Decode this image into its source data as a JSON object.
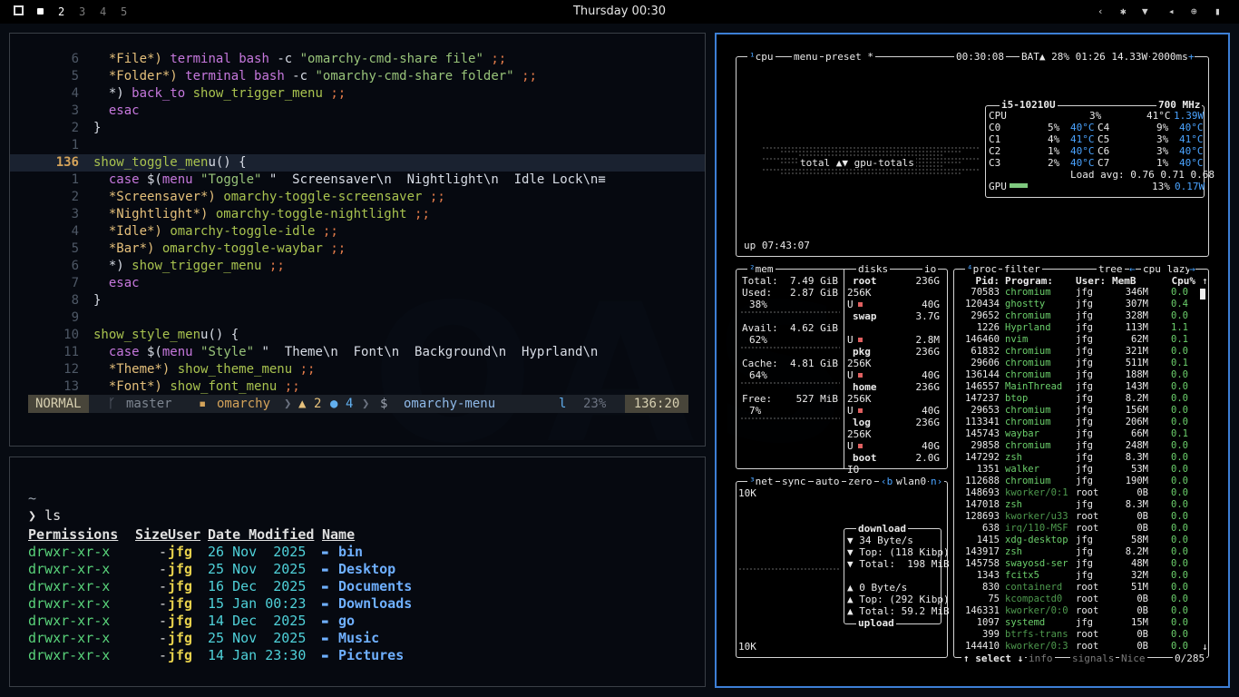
{
  "topbar": {
    "workspaces": [
      "2",
      "3",
      "4",
      "5"
    ],
    "clock": "Thursday 00:30"
  },
  "editor": {
    "lines": [
      {
        "num": "6",
        "code": "  *File*) terminal bash -c \"omarchy-cmd-share file\" ;;"
      },
      {
        "num": "5",
        "code": "  *Folder*) terminal bash -c \"omarchy-cmd-share folder\" ;;"
      },
      {
        "num": "4",
        "code": "  *) back_to show_trigger_menu ;;"
      },
      {
        "num": "3",
        "code": "  esac"
      },
      {
        "num": "2",
        "code": "}"
      },
      {
        "num": "1",
        "code": ""
      },
      {
        "num": "136",
        "code": "show_toggle_menu() {",
        "current": true
      },
      {
        "num": "1",
        "code": "  case $(menu \"Toggle\" \"  Screensaver\\n  Nightlight\\n  Idle Lock\\n≡"
      },
      {
        "num": "2",
        "code": "  *Screensaver*) omarchy-toggle-screensaver ;;"
      },
      {
        "num": "3",
        "code": "  *Nightlight*) omarchy-toggle-nightlight ;;"
      },
      {
        "num": "4",
        "code": "  *Idle*) omarchy-toggle-idle ;;"
      },
      {
        "num": "5",
        "code": "  *Bar*) omarchy-toggle-waybar ;;"
      },
      {
        "num": "6",
        "code": "  *) show_trigger_menu ;;"
      },
      {
        "num": "7",
        "code": "  esac"
      },
      {
        "num": "8",
        "code": "}"
      },
      {
        "num": "9",
        "code": ""
      },
      {
        "num": "10",
        "code": "show_style_menu() {"
      },
      {
        "num": "11",
        "code": "  case $(menu \"Style\" \"  Theme\\n  Font\\n  Background\\n  Hyprland\\n"
      },
      {
        "num": "12",
        "code": "  *Theme*) show_theme_menu ;;"
      },
      {
        "num": "13",
        "code": "  *Font*) show_font_menu ;;"
      }
    ],
    "status": {
      "mode": "NORMAL",
      "branch": "master",
      "dir": "omarchy",
      "warnings": "2",
      "infos": "4",
      "prompt": "$",
      "file": "omarchy-menu",
      "ft": "l",
      "percent": "23%",
      "position": "136:20"
    }
  },
  "terminal": {
    "cwd": "~",
    "command": "ls",
    "headers": [
      "Permissions",
      "Size",
      "User",
      "Date Modified",
      "Name"
    ],
    "rows": [
      {
        "perm": "drwxr-xr-x",
        "size": "-",
        "user": "jfg",
        "date": "26 Nov  2025",
        "name": "bin"
      },
      {
        "perm": "drwxr-xr-x",
        "size": "-",
        "user": "jfg",
        "date": "25 Nov  2025",
        "name": "Desktop"
      },
      {
        "perm": "drwxr-xr-x",
        "size": "-",
        "user": "jfg",
        "date": "16 Dec  2025",
        "name": "Documents"
      },
      {
        "perm": "drwxr-xr-x",
        "size": "-",
        "user": "jfg",
        "date": "15 Jan 00:23",
        "name": "Downloads"
      },
      {
        "perm": "drwxr-xr-x",
        "size": "-",
        "user": "jfg",
        "date": "14 Dec  2025",
        "name": "go"
      },
      {
        "perm": "drwxr-xr-x",
        "size": "-",
        "user": "jfg",
        "date": "25 Nov  2025",
        "name": "Music"
      },
      {
        "perm": "drwxr-xr-x",
        "size": "-",
        "user": "jfg",
        "date": "14 Jan 23:30",
        "name": "Pictures"
      }
    ]
  },
  "btop": {
    "cpu": {
      "title": "cpu",
      "menu": "menu",
      "preset": "preset *",
      "time": "00:30:08",
      "battery": "BAT▲ 28% 01:26 14.33W",
      "interval": "2000ms",
      "model": "i5-10210U",
      "freq": "700 MHz",
      "cores": [
        {
          "name": "CPU",
          "pct": "3%",
          "temp": "41°C",
          "extra": "1.39W"
        },
        {
          "name": "C0",
          "pct": "5%",
          "temp": "40°C"
        },
        {
          "name": "C1",
          "pct": "4%",
          "temp": "41°C"
        },
        {
          "name": "C2",
          "pct": "1%",
          "temp": "40°C"
        },
        {
          "name": "C3",
          "pct": "2%",
          "temp": "40°C"
        }
      ],
      "cores_right": [
        {
          "name": "C4",
          "pct": "9%",
          "temp": "40°C"
        },
        {
          "name": "C5",
          "pct": "3%",
          "temp": "41°C"
        },
        {
          "name": "C6",
          "pct": "3%",
          "temp": "40°C"
        },
        {
          "name": "C7",
          "pct": "1%",
          "temp": "40°C"
        }
      ],
      "load": "Load avg: 0.76 0.71 0.68",
      "gpu_label": "GPU",
      "gpu_pct": "13%",
      "gpu_w": "0.17W",
      "graph_label": "total ▲▼ gpu-totals",
      "uptime": "up 07:43:07"
    },
    "mem": {
      "title": "mem",
      "disks": "disks",
      "io": "io",
      "total": "7.49 GiB",
      "used": "2.87 GiB",
      "used_pct": "38%",
      "avail": "4.62 GiB",
      "avail_pct": "62%",
      "cache": "4.81 GiB",
      "cache_pct": "64%",
      "free": "527 MiB",
      "free_pct": "7%",
      "disk_list": [
        {
          "name": "root",
          "size": "236G",
          "a": "256K",
          "b": "40G"
        },
        {
          "name": "swap",
          "size": "3.7G",
          "a": "",
          "b": "2.8M"
        },
        {
          "name": "pkg",
          "size": "236G",
          "a": "256K",
          "b": "40G"
        },
        {
          "name": "home",
          "size": "236G",
          "a": "256K",
          "b": "40G"
        },
        {
          "name": "log",
          "size": "236G",
          "a": "256K",
          "b": "40G"
        },
        {
          "name": "boot",
          "size": "2.0G",
          "a": "IO",
          "b": ""
        }
      ]
    },
    "net": {
      "title": "net",
      "sync": "sync",
      "auto": "auto",
      "zero": "zero",
      "iface": "wlan0",
      "scale_top": "10K",
      "scale_bottom": "10K",
      "download": "download",
      "dl_rate": "▼ 34 Byte/s",
      "dl_top": "▼ Top: (118 Kibp)",
      "dl_total": "▼ Total:  198 MiB",
      "ul_rate": "▲ 0 Byte/s",
      "ul_top": "▲ Top: (292 Kibp)",
      "ul_total": "▲ Total: 59.2 MiB",
      "upload": "upload"
    },
    "proc": {
      "title": "proc",
      "filter": "filter",
      "tree": "tree",
      "sort": "cpu lazy",
      "headers": [
        "Pid:",
        "Program:",
        "User:",
        "MemB",
        "Cpu%"
      ],
      "rows": [
        [
          "70583",
          "chromium",
          "jfg",
          "346M",
          "0.0"
        ],
        [
          "120434",
          "ghostty",
          "jfg",
          "307M",
          "0.4"
        ],
        [
          "29652",
          "chromium",
          "jfg",
          "328M",
          "0.0"
        ],
        [
          "1226",
          "Hyprland",
          "jfg",
          "113M",
          "1.1"
        ],
        [
          "146460",
          "nvim",
          "jfg",
          "62M",
          "0.1"
        ],
        [
          "61832",
          "chromium",
          "jfg",
          "321M",
          "0.0"
        ],
        [
          "29606",
          "chromium",
          "jfg",
          "511M",
          "0.1"
        ],
        [
          "136144",
          "chromium",
          "jfg",
          "188M",
          "0.0"
        ],
        [
          "146557",
          "MainThread",
          "jfg",
          "143M",
          "0.0"
        ],
        [
          "147237",
          "btop",
          "jfg",
          "8.2M",
          "0.0"
        ],
        [
          "29653",
          "chromium",
          "jfg",
          "156M",
          "0.0"
        ],
        [
          "113341",
          "chromium",
          "jfg",
          "206M",
          "0.0"
        ],
        [
          "145743",
          "waybar",
          "jfg",
          "66M",
          "0.1"
        ],
        [
          "29858",
          "chromium",
          "jfg",
          "248M",
          "0.0"
        ],
        [
          "147292",
          "zsh",
          "jfg",
          "8.3M",
          "0.0"
        ],
        [
          "1351",
          "walker",
          "jfg",
          "53M",
          "0.0"
        ],
        [
          "112688",
          "chromium",
          "jfg",
          "190M",
          "0.0"
        ],
        [
          "148693",
          "kworker/0:1",
          "root",
          "0B",
          "0.0"
        ],
        [
          "147018",
          "zsh",
          "jfg",
          "8.3M",
          "0.0"
        ],
        [
          "128693",
          "kworker/u33",
          "root",
          "0B",
          "0.0"
        ],
        [
          "638",
          "irq/110-MSF",
          "root",
          "0B",
          "0.0"
        ],
        [
          "1415",
          "xdg-desktop",
          "jfg",
          "58M",
          "0.0"
        ],
        [
          "143917",
          "zsh",
          "jfg",
          "8.2M",
          "0.0"
        ],
        [
          "145758",
          "swayosd-ser",
          "jfg",
          "48M",
          "0.0"
        ],
        [
          "1343",
          "fcitx5",
          "jfg",
          "32M",
          "0.0"
        ],
        [
          "830",
          "containerd",
          "root",
          "51M",
          "0.0"
        ],
        [
          "75",
          "kcompactd0",
          "root",
          "0B",
          "0.0"
        ],
        [
          "146331",
          "kworker/0:0",
          "root",
          "0B",
          "0.0"
        ],
        [
          "1097",
          "systemd",
          "jfg",
          "15M",
          "0.0"
        ],
        [
          "399",
          "btrfs-trans",
          "root",
          "0B",
          "0.0"
        ],
        [
          "144410",
          "kworker/0:3",
          "root",
          "0B",
          "0.0"
        ]
      ],
      "footer_select": "select",
      "footer_info": "info",
      "footer_signals": "signals",
      "footer_nice": "Nice",
      "footer_count": "0/285"
    }
  },
  "colors": {
    "accent": "#3d7fd6",
    "green": "#6bcf6b",
    "red": "#e06060",
    "blue": "#4aa3ff"
  }
}
